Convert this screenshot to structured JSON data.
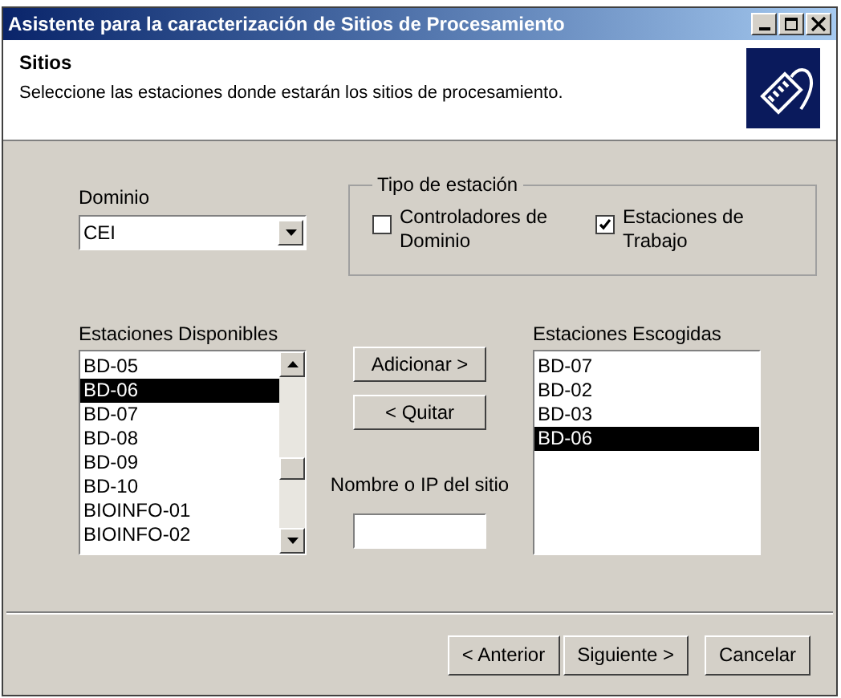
{
  "window": {
    "title": "Asistente para la caracterización de Sitios de Procesamiento",
    "controls": [
      {
        "kind": "minimize"
      },
      {
        "kind": "maximize"
      },
      {
        "kind": "close"
      }
    ]
  },
  "header": {
    "title": "Sitios",
    "subtitle": "Seleccione las estaciones donde estarán los sitios de procesamiento."
  },
  "domain": {
    "label": "Dominio",
    "value": "CEI"
  },
  "station_type": {
    "legend": "Tipo de estación",
    "options": [
      {
        "label": "Controladores de Dominio",
        "checked": false
      },
      {
        "label": "Estaciones de Trabajo",
        "checked": true
      }
    ]
  },
  "available": {
    "label": "Estaciones Disponibles",
    "items": [
      {
        "text": "BD-05",
        "selected": false
      },
      {
        "text": "BD-06",
        "selected": true
      },
      {
        "text": "BD-07",
        "selected": false
      },
      {
        "text": "BD-08",
        "selected": false
      },
      {
        "text": "BD-09",
        "selected": false
      },
      {
        "text": "BD-10",
        "selected": false
      },
      {
        "text": "BIOINFO-01",
        "selected": false
      },
      {
        "text": "BIOINFO-02",
        "selected": false
      }
    ]
  },
  "actions": {
    "add": "Adicionar >",
    "remove": "< Quitar",
    "site_label": "Nombre o IP del sitio"
  },
  "chosen": {
    "label": "Estaciones Escogidas",
    "items": [
      {
        "text": "BD-07",
        "selected": false
      },
      {
        "text": "BD-02",
        "selected": false
      },
      {
        "text": "BD-03",
        "selected": false
      },
      {
        "text": "BD-06",
        "selected": true
      }
    ]
  },
  "buttons": [
    "< Anterior",
    "Siguiente >",
    "Cancelar"
  ]
}
